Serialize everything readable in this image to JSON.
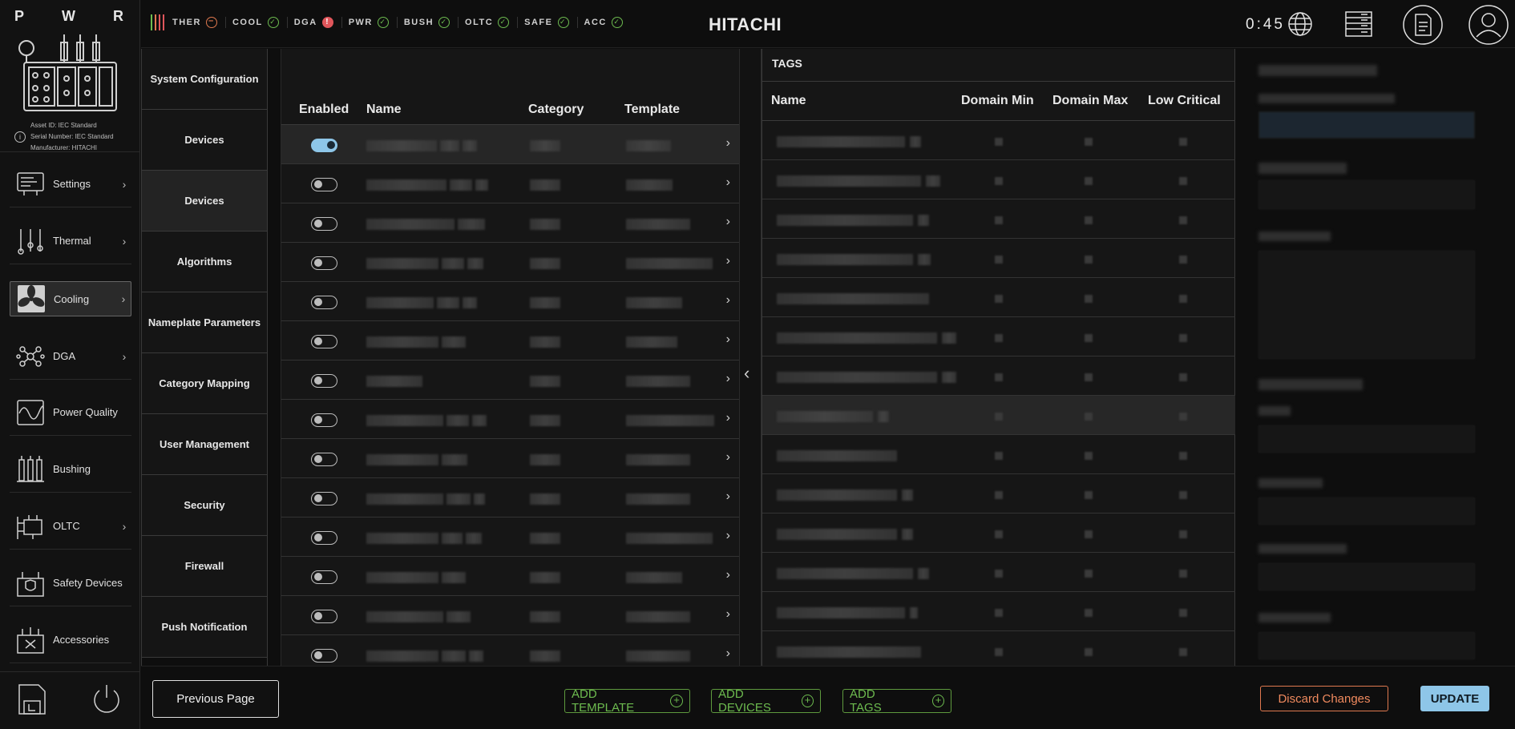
{
  "brand": {
    "letters": [
      "P",
      "W",
      "R"
    ],
    "asset_id": "Asset ID: IEC Standard",
    "serial": "Serial Number: IEC Standard",
    "manufacturer": "Manufacturer: HITACHI"
  },
  "nav": [
    {
      "label": "Settings",
      "icon": "settings-icon",
      "chevron": true
    },
    {
      "label": "Thermal",
      "icon": "thermal-icon",
      "chevron": true
    },
    {
      "label": "Cooling",
      "icon": "fan-icon",
      "chevron": true
    },
    {
      "label": "DGA",
      "icon": "dga-icon",
      "chevron": true
    },
    {
      "label": "Power Quality",
      "icon": "power-quality-icon",
      "chevron": false
    },
    {
      "label": "Bushing",
      "icon": "bushing-icon",
      "chevron": false
    },
    {
      "label": "OLTC",
      "icon": "oltc-icon",
      "chevron": true
    },
    {
      "label": "Safety Devices",
      "icon": "safety-devices-icon",
      "chevron": false
    },
    {
      "label": "Accessories",
      "icon": "accessories-icon",
      "chevron": false
    }
  ],
  "status": [
    {
      "label": "THER",
      "state": "warning"
    },
    {
      "label": "COOL",
      "state": "ok"
    },
    {
      "label": "DGA",
      "state": "alert"
    },
    {
      "label": "PWR",
      "state": "ok"
    },
    {
      "label": "BUSH",
      "state": "ok"
    },
    {
      "label": "OLTC",
      "state": "ok"
    },
    {
      "label": "SAFE",
      "state": "ok"
    },
    {
      "label": "ACC",
      "state": "ok"
    }
  ],
  "header": {
    "logo": "HITACHI",
    "clock": "0:45"
  },
  "submenu": [
    "System Configuration",
    "Devices",
    "Devices",
    "Algorithms",
    "Nameplate Parameters",
    "Category Mapping",
    "User Management",
    "Security",
    "Firewall",
    "Push Notification"
  ],
  "devices": {
    "columns": {
      "enabled": "Enabled",
      "name": "Name",
      "category": "Category",
      "template": "Template"
    },
    "rows": [
      {
        "enabled": true
      },
      {
        "enabled": false
      },
      {
        "enabled": false
      },
      {
        "enabled": false
      },
      {
        "enabled": false
      },
      {
        "enabled": false
      },
      {
        "enabled": false
      },
      {
        "enabled": false
      },
      {
        "enabled": false
      },
      {
        "enabled": false
      },
      {
        "enabled": false
      },
      {
        "enabled": false
      },
      {
        "enabled": false
      },
      {
        "enabled": false
      }
    ]
  },
  "tags": {
    "title": "TAGS",
    "columns": {
      "name": "Name",
      "domain_min": "Domain Min",
      "domain_max": "Domain Max",
      "low_critical": "Low Critical"
    },
    "row_count": 14
  },
  "bottom": {
    "previous": "Previous Page",
    "add_template": "ADD TEMPLATE",
    "add_devices": "ADD DEVICES",
    "add_tags": "ADD TAGS",
    "discard": "Discard Changes",
    "update": "UPDATE"
  },
  "colors": {
    "ok": "#6dbb4f",
    "warning": "#e0794f",
    "alert": "#e0565b",
    "accent": "#8ec6e8"
  }
}
